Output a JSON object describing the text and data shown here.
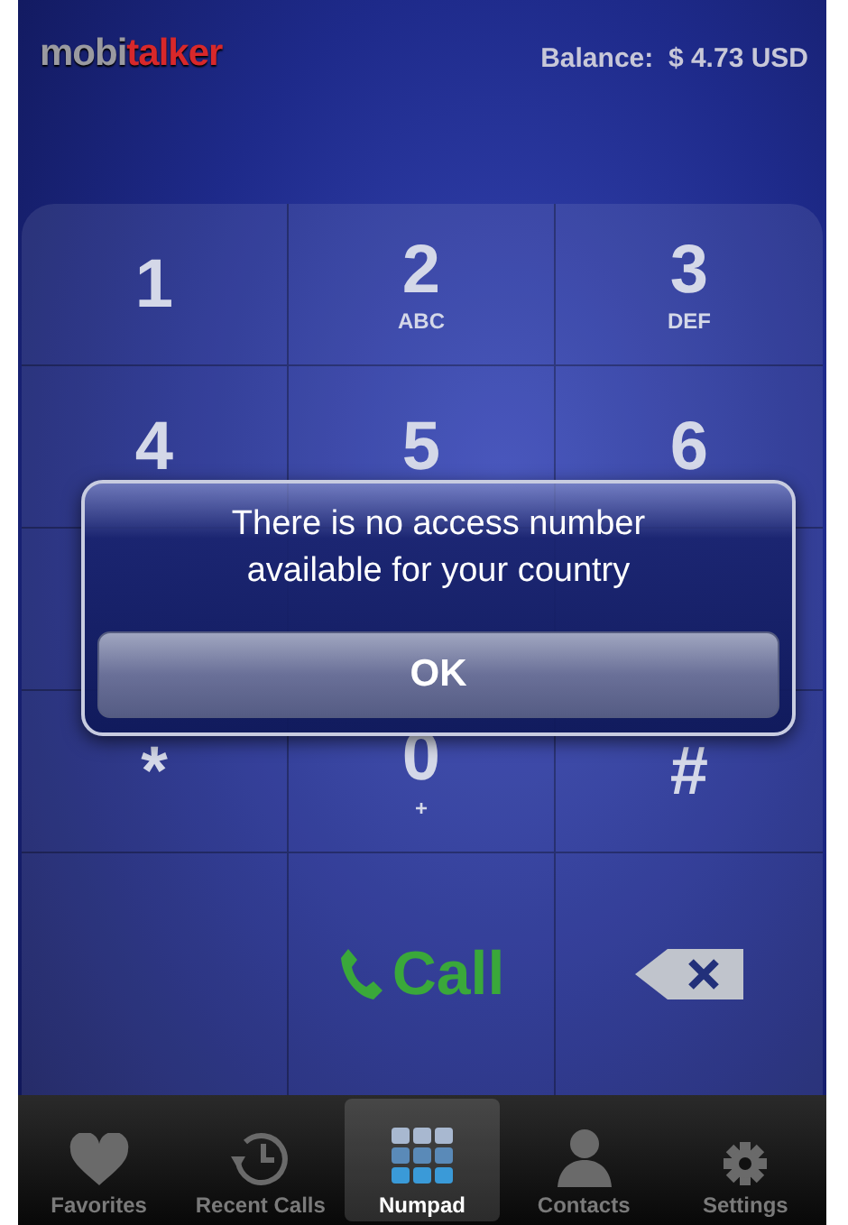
{
  "header": {
    "logo_left": "mobi",
    "logo_right": "talker",
    "balance": "Balance:  $ 4.73 USD"
  },
  "keypad": [
    {
      "digit": "1"
    },
    {
      "digit": "2",
      "letters": "ABC"
    },
    {
      "digit": "3",
      "letters": "DEF"
    },
    {
      "digit": "4"
    },
    {
      "digit": "5"
    },
    {
      "digit": "6"
    },
    {
      "digit": "*"
    },
    {
      "digit": "0",
      "letters": "+"
    },
    {
      "digit": "#"
    }
  ],
  "call_button": {
    "label": "Call"
  },
  "dialog": {
    "message": "There is no access number available for your country",
    "button": "OK"
  },
  "tabs": [
    {
      "label": "Favorites",
      "kind": "heart",
      "selected": false
    },
    {
      "label": "Recent Calls",
      "kind": "clock",
      "selected": false
    },
    {
      "label": "Numpad",
      "kind": "grid",
      "selected": true
    },
    {
      "label": "Contacts",
      "kind": "person",
      "selected": false
    },
    {
      "label": "Settings",
      "kind": "gear",
      "selected": false
    }
  ]
}
